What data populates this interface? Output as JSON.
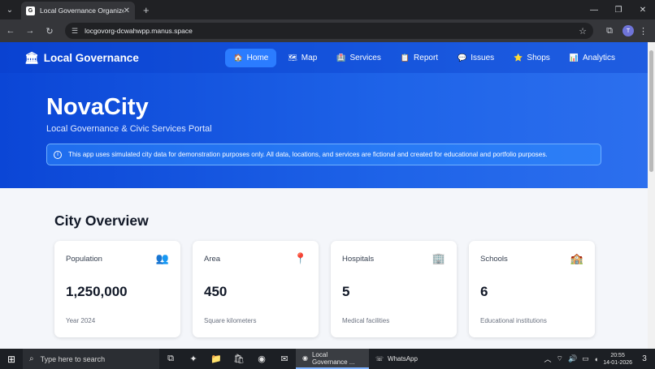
{
  "browser": {
    "tab_title": "Local Governance Organizer",
    "tab_favicon": "G",
    "tab_close": "✕",
    "new_tab": "+",
    "url": "locgovorg-dcwahwpp.manus.space",
    "profile_initial": "T"
  },
  "nav": {
    "brand": "Local Governance",
    "items": [
      {
        "label": "Home",
        "icon": "🏠",
        "active": true
      },
      {
        "label": "Map",
        "icon": "🗺",
        "active": false
      },
      {
        "label": "Services",
        "icon": "🏥",
        "active": false
      },
      {
        "label": "Report",
        "icon": "📋",
        "active": false
      },
      {
        "label": "Issues",
        "icon": "💬",
        "active": false
      },
      {
        "label": "Shops",
        "icon": "⭐",
        "active": false
      },
      {
        "label": "Analytics",
        "icon": "📊",
        "active": false
      }
    ]
  },
  "hero": {
    "title": "NovaCity",
    "subtitle": "Local Governance & Civic Services Portal",
    "notice": "This app uses simulated city data for demonstration purposes only. All data, locations, and services are fictional and created for educational and portfolio purposes."
  },
  "overview": {
    "heading": "City Overview",
    "cards": [
      {
        "label": "Population",
        "value": "1,250,000",
        "note": "Year 2024",
        "icon": "users-icon",
        "color": "#2563eb"
      },
      {
        "label": "Area",
        "value": "450",
        "note": "Square kilometers",
        "icon": "map-pin-icon",
        "color": "#16a34a"
      },
      {
        "label": "Hospitals",
        "value": "5",
        "note": "Medical facilities",
        "icon": "hospital-icon",
        "color": "#dc2626"
      },
      {
        "label": "Schools",
        "value": "6",
        "note": "Educational institutions",
        "icon": "school-icon",
        "color": "#a21caf"
      }
    ]
  },
  "taskbar": {
    "search_placeholder": "Type here to search",
    "apps": [
      {
        "label": "Local Governance ...",
        "active": true
      },
      {
        "label": "WhatsApp",
        "active": false
      }
    ],
    "time": "20:55",
    "date": "14-01-2026",
    "notifications": "3"
  }
}
